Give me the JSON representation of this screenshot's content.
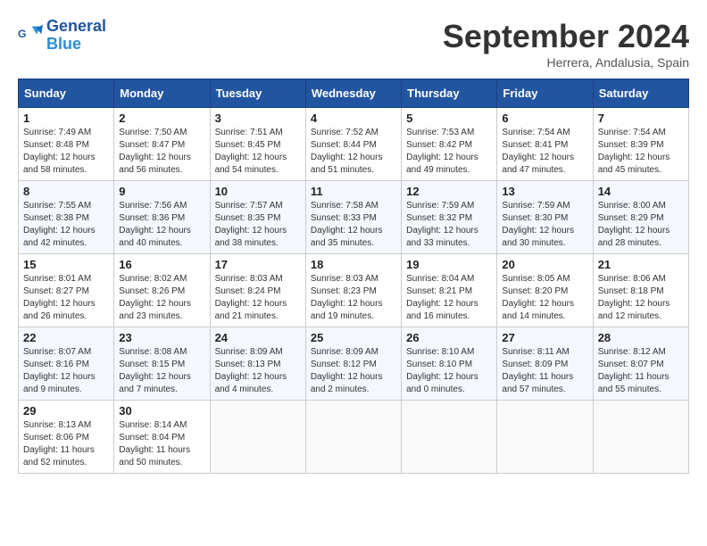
{
  "header": {
    "logo_line1": "General",
    "logo_line2": "Blue",
    "month_title": "September 2024",
    "location": "Herrera, Andalusia, Spain"
  },
  "weekdays": [
    "Sunday",
    "Monday",
    "Tuesday",
    "Wednesday",
    "Thursday",
    "Friday",
    "Saturday"
  ],
  "weeks": [
    [
      {
        "day": "1",
        "sunrise": "7:49 AM",
        "sunset": "8:48 PM",
        "daylight": "12 hours and 58 minutes."
      },
      {
        "day": "2",
        "sunrise": "7:50 AM",
        "sunset": "8:47 PM",
        "daylight": "12 hours and 56 minutes."
      },
      {
        "day": "3",
        "sunrise": "7:51 AM",
        "sunset": "8:45 PM",
        "daylight": "12 hours and 54 minutes."
      },
      {
        "day": "4",
        "sunrise": "7:52 AM",
        "sunset": "8:44 PM",
        "daylight": "12 hours and 51 minutes."
      },
      {
        "day": "5",
        "sunrise": "7:53 AM",
        "sunset": "8:42 PM",
        "daylight": "12 hours and 49 minutes."
      },
      {
        "day": "6",
        "sunrise": "7:54 AM",
        "sunset": "8:41 PM",
        "daylight": "12 hours and 47 minutes."
      },
      {
        "day": "7",
        "sunrise": "7:54 AM",
        "sunset": "8:39 PM",
        "daylight": "12 hours and 45 minutes."
      }
    ],
    [
      {
        "day": "8",
        "sunrise": "7:55 AM",
        "sunset": "8:38 PM",
        "daylight": "12 hours and 42 minutes."
      },
      {
        "day": "9",
        "sunrise": "7:56 AM",
        "sunset": "8:36 PM",
        "daylight": "12 hours and 40 minutes."
      },
      {
        "day": "10",
        "sunrise": "7:57 AM",
        "sunset": "8:35 PM",
        "daylight": "12 hours and 38 minutes."
      },
      {
        "day": "11",
        "sunrise": "7:58 AM",
        "sunset": "8:33 PM",
        "daylight": "12 hours and 35 minutes."
      },
      {
        "day": "12",
        "sunrise": "7:59 AM",
        "sunset": "8:32 PM",
        "daylight": "12 hours and 33 minutes."
      },
      {
        "day": "13",
        "sunrise": "7:59 AM",
        "sunset": "8:30 PM",
        "daylight": "12 hours and 30 minutes."
      },
      {
        "day": "14",
        "sunrise": "8:00 AM",
        "sunset": "8:29 PM",
        "daylight": "12 hours and 28 minutes."
      }
    ],
    [
      {
        "day": "15",
        "sunrise": "8:01 AM",
        "sunset": "8:27 PM",
        "daylight": "12 hours and 26 minutes."
      },
      {
        "day": "16",
        "sunrise": "8:02 AM",
        "sunset": "8:26 PM",
        "daylight": "12 hours and 23 minutes."
      },
      {
        "day": "17",
        "sunrise": "8:03 AM",
        "sunset": "8:24 PM",
        "daylight": "12 hours and 21 minutes."
      },
      {
        "day": "18",
        "sunrise": "8:03 AM",
        "sunset": "8:23 PM",
        "daylight": "12 hours and 19 minutes."
      },
      {
        "day": "19",
        "sunrise": "8:04 AM",
        "sunset": "8:21 PM",
        "daylight": "12 hours and 16 minutes."
      },
      {
        "day": "20",
        "sunrise": "8:05 AM",
        "sunset": "8:20 PM",
        "daylight": "12 hours and 14 minutes."
      },
      {
        "day": "21",
        "sunrise": "8:06 AM",
        "sunset": "8:18 PM",
        "daylight": "12 hours and 12 minutes."
      }
    ],
    [
      {
        "day": "22",
        "sunrise": "8:07 AM",
        "sunset": "8:16 PM",
        "daylight": "12 hours and 9 minutes."
      },
      {
        "day": "23",
        "sunrise": "8:08 AM",
        "sunset": "8:15 PM",
        "daylight": "12 hours and 7 minutes."
      },
      {
        "day": "24",
        "sunrise": "8:09 AM",
        "sunset": "8:13 PM",
        "daylight": "12 hours and 4 minutes."
      },
      {
        "day": "25",
        "sunrise": "8:09 AM",
        "sunset": "8:12 PM",
        "daylight": "12 hours and 2 minutes."
      },
      {
        "day": "26",
        "sunrise": "8:10 AM",
        "sunset": "8:10 PM",
        "daylight": "12 hours and 0 minutes."
      },
      {
        "day": "27",
        "sunrise": "8:11 AM",
        "sunset": "8:09 PM",
        "daylight": "11 hours and 57 minutes."
      },
      {
        "day": "28",
        "sunrise": "8:12 AM",
        "sunset": "8:07 PM",
        "daylight": "11 hours and 55 minutes."
      }
    ],
    [
      {
        "day": "29",
        "sunrise": "8:13 AM",
        "sunset": "8:06 PM",
        "daylight": "11 hours and 52 minutes."
      },
      {
        "day": "30",
        "sunrise": "8:14 AM",
        "sunset": "8:04 PM",
        "daylight": "11 hours and 50 minutes."
      },
      null,
      null,
      null,
      null,
      null
    ]
  ]
}
